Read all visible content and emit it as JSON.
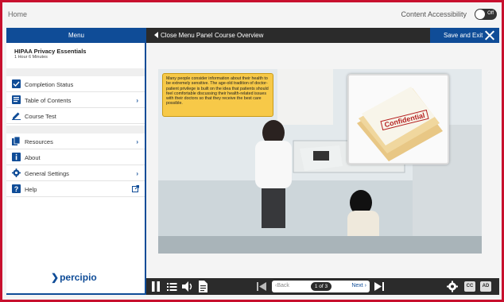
{
  "topbar": {
    "home_label": "Home",
    "accessibility_label": "Content Accessibility",
    "toggle_state": "Off"
  },
  "header": {
    "menu_label": "Menu",
    "close_menu_label": "Close Menu Panel",
    "course_title": "Course Overview",
    "save_exit_label": "Save and Exit"
  },
  "sidebar": {
    "course_name": "HIPAA Privacy Essentials",
    "course_duration": "1 Hour 6 Minutes",
    "items": [
      {
        "label": "Completion Status",
        "icon": "checkbox-icon"
      },
      {
        "label": "Table of Contents",
        "icon": "book-icon"
      },
      {
        "label": "Course Test",
        "icon": "pencil-icon"
      }
    ],
    "items2": [
      {
        "label": "Resources",
        "icon": "documents-icon"
      },
      {
        "label": "About",
        "icon": "info-icon"
      },
      {
        "label": "General Settings",
        "icon": "gear-icon"
      },
      {
        "label": "Help",
        "icon": "help-icon"
      }
    ],
    "logo_text": "percipio"
  },
  "slide": {
    "callout_text": "Many people consider information about their health to be extremely sensitive. The age-old tradition of doctor-patient privilege is built on the idea that patients should feel comfortable discussing their health-related issues with their doctors so that they receive the best care possible.",
    "stamp_text": "Confidential"
  },
  "controls": {
    "back_label": "Back",
    "page_indicator": "1 of 3",
    "next_label": "Next",
    "cc_label": "CC",
    "ad_label": "AD"
  },
  "colors": {
    "brand_blue": "#0f4c97",
    "frame_red": "#c8102e",
    "callout_yellow": "#f7c948",
    "dark_bar": "#2b2b2b"
  }
}
